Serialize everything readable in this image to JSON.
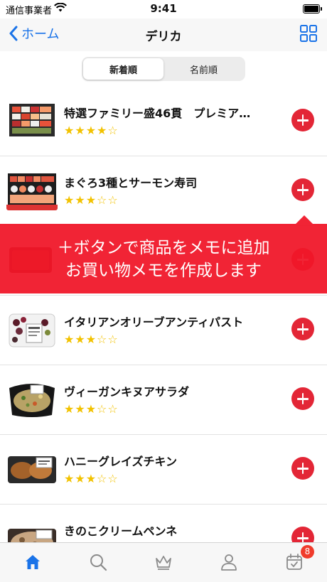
{
  "status_bar": {
    "carrier": "通信事業者",
    "time": "9:41"
  },
  "nav": {
    "back_label": "ホーム",
    "title": "デリカ"
  },
  "segments": [
    {
      "label": "新着順",
      "active": true
    },
    {
      "label": "名前順",
      "active": false
    }
  ],
  "items": [
    {
      "name": "特選ファミリー盛46貫　プレミア…",
      "stars": "★★★★☆",
      "rating": 4
    },
    {
      "name": "まぐろ3種とサーモン寿司",
      "stars": "★★★☆☆",
      "rating": 3
    },
    {
      "name": "",
      "stars": "",
      "rating": null
    },
    {
      "name": "イタリアンオリーブアンティパスト",
      "stars": "★★★☆☆",
      "rating": 3
    },
    {
      "name": "ヴィーガンキヌアサラダ",
      "stars": "★★★☆☆",
      "rating": 3
    },
    {
      "name": "ハニーグレイズチキン",
      "stars": "★★★☆☆",
      "rating": 3
    },
    {
      "name": "きのこクリームペンネ",
      "stars": "",
      "rating": null
    }
  ],
  "banner": {
    "line1": "＋ボタンで商品をメモに追加",
    "line2": "お買い物メモを作成します"
  },
  "tabs": [
    {
      "icon": "home-icon",
      "active": true
    },
    {
      "icon": "search-icon",
      "active": false
    },
    {
      "icon": "crown-icon",
      "active": false
    },
    {
      "icon": "person-icon",
      "active": false
    },
    {
      "icon": "calendar-icon",
      "active": false,
      "badge": "8"
    }
  ],
  "colors": {
    "accent_blue": "#1a73e8",
    "add_red": "#e32636",
    "banner_red": "#f01628",
    "star_yellow": "#f2c200"
  }
}
